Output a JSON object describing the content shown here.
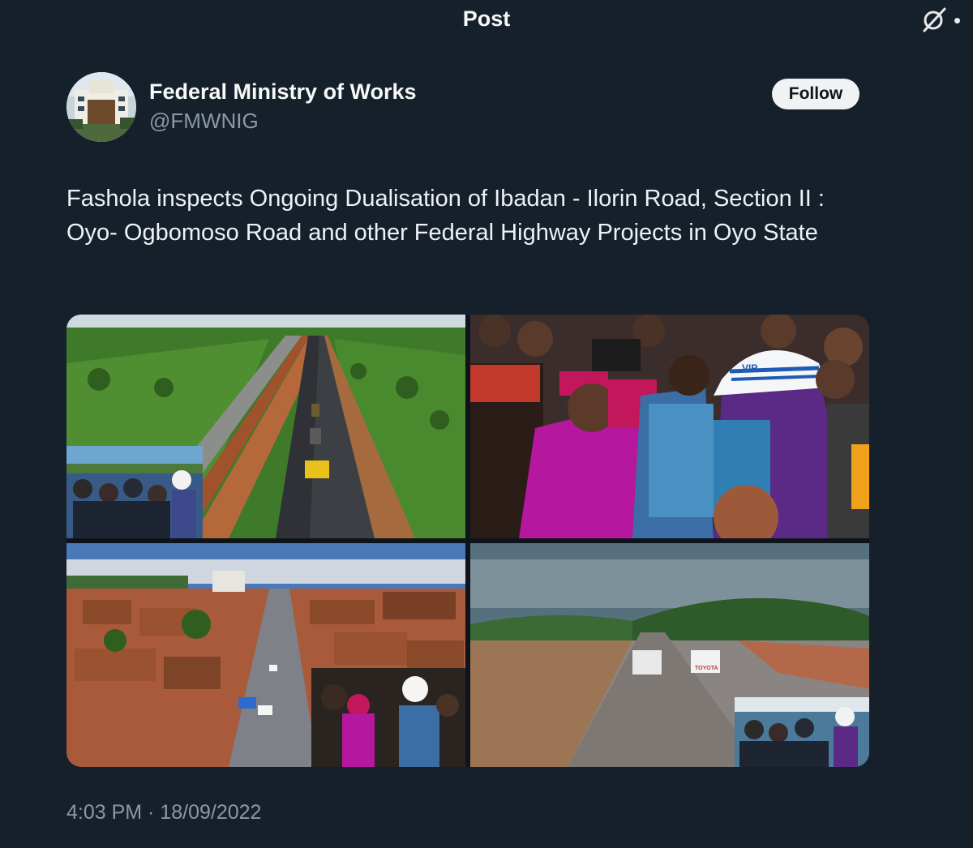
{
  "header": {
    "title": "Post"
  },
  "author": {
    "name": "Federal Ministry of Works",
    "handle": "@FMWNIG"
  },
  "actions": {
    "follow_label": "Follow"
  },
  "post": {
    "text": "Fashola inspects Ongoing Dualisation of Ibadan - Ilorin Road, Section II : Oyo- Ogbomoso Road and other Federal Highway Projects in Oyo State",
    "timestamp": "4:03 PM · 18/09/2022"
  },
  "media": {
    "photo2_hat_text": "VIP",
    "photo4_vehicle_text": "TOYOTA"
  },
  "icons": {
    "grok": "grok-icon",
    "more": "more-icon"
  }
}
